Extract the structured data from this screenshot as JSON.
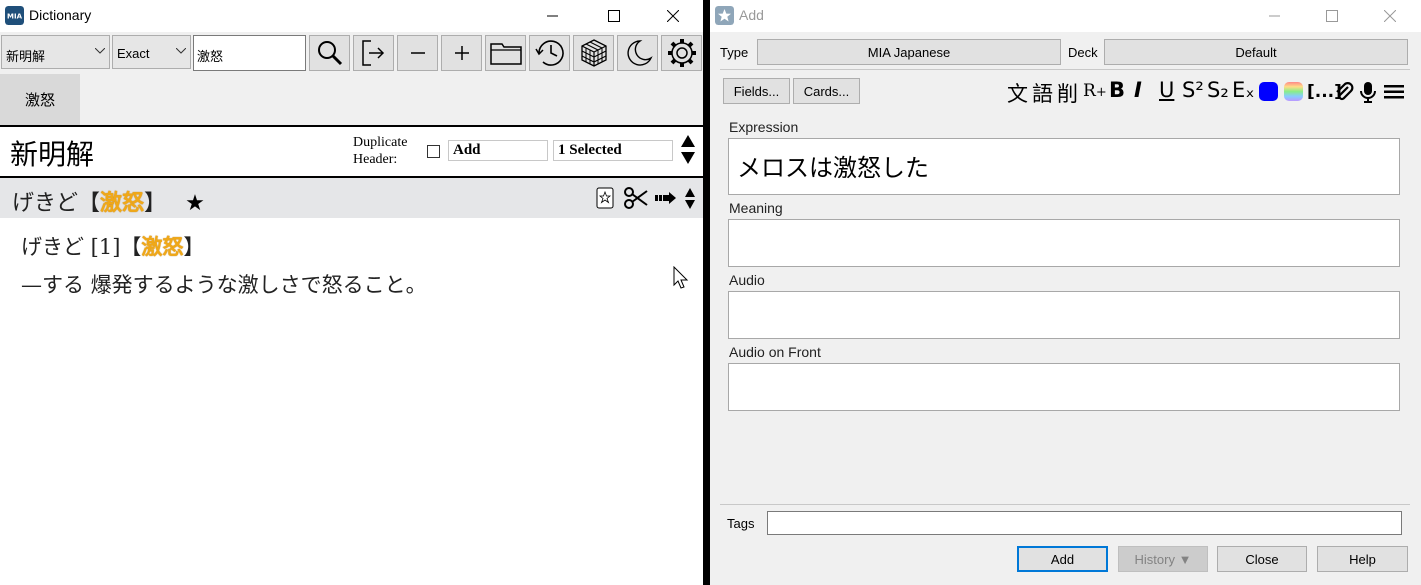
{
  "dictionary": {
    "window_title": "Dictionary",
    "dict_select": "新明解",
    "match_select": "Exact",
    "search_value": "激怒",
    "tab_label": "激怒",
    "dict_name": "新明解",
    "duplicate_header_label_1": "Duplicate",
    "duplicate_header_label_2": "Header:",
    "add_field": "Add",
    "selected_field": "1 Selected",
    "entry": {
      "head_reading": "げきど",
      "head_bracket_open": "【",
      "head_word": "激怒",
      "head_bracket_close": "】",
      "star": "★",
      "body_reading": "げきど [1]",
      "body_bracket_open": "【",
      "body_word": "激怒",
      "body_bracket_close": "】",
      "definition": "—する 爆発するような激しさで怒ること。"
    },
    "accent_color": "#f0a818"
  },
  "add": {
    "window_title": "Add",
    "type_label": "Type",
    "type_value": "MIA Japanese",
    "deck_label": "Deck",
    "deck_value": "Default",
    "fields_button": "Fields...",
    "cards_button": "Cards...",
    "format_tools": [
      "文",
      "語",
      "削",
      "R",
      "B",
      "I",
      "U",
      "S²",
      "S₂",
      "Eₓ",
      "[...]"
    ],
    "fields": [
      {
        "label": "Expression",
        "value": "メロスは激怒した"
      },
      {
        "label": "Meaning",
        "value": ""
      },
      {
        "label": "Audio",
        "value": ""
      },
      {
        "label": "Audio on Front",
        "value": ""
      }
    ],
    "tags_label": "Tags",
    "buttons": {
      "add": "Add",
      "history": "History ▼",
      "close": "Close",
      "help": "Help"
    },
    "color_swatch": "#0000ff"
  }
}
